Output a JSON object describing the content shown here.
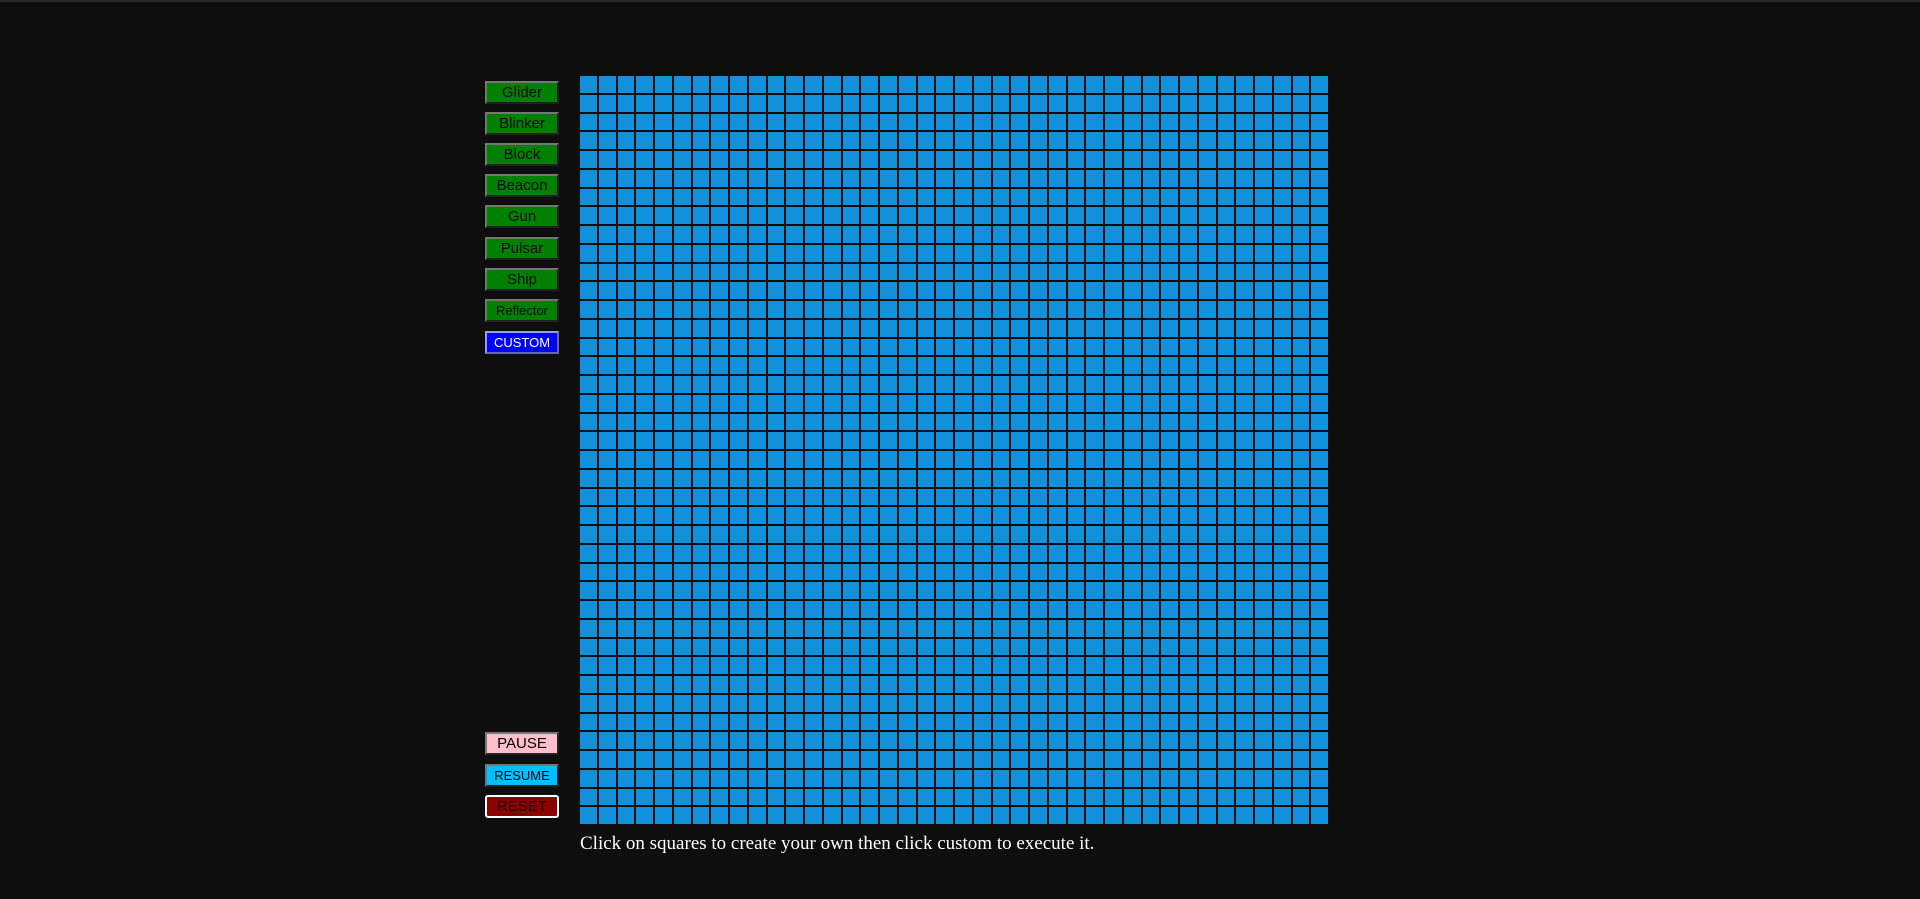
{
  "patterns": {
    "glider": "Glider",
    "blinker": "Blinker",
    "block": "Block",
    "beacon": "Beacon",
    "gun": "Gun",
    "pulsar": "Pulsar",
    "ship": "Ship",
    "reflector": "Reflector",
    "custom": "CUSTOM"
  },
  "controls": {
    "pause": "PAUSE",
    "resume": "RESUME",
    "reset": "RESET"
  },
  "grid": {
    "rows": 40,
    "columns": 40,
    "cell_color": "#1191dc"
  },
  "instructions": "Click on squares to create your own then click custom to execute it.",
  "colors": {
    "background": "#0e0e0e",
    "pattern_button": "#008000",
    "custom_button": "#0000ff",
    "pause_button": "#ffc0cb",
    "resume_button": "#00bfff",
    "reset_button": "#8b0000"
  }
}
